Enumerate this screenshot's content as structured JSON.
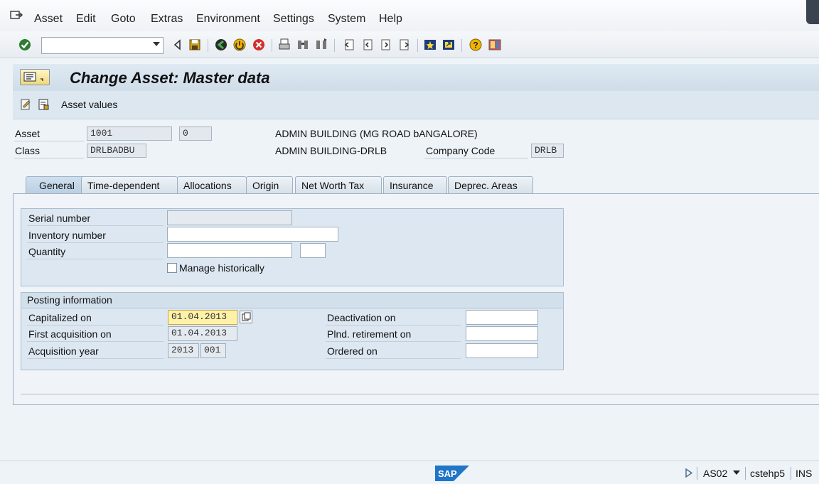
{
  "menu": {
    "items": [
      "Asset",
      "Edit",
      "Goto",
      "Extras",
      "Environment",
      "Settings",
      "System",
      "Help"
    ]
  },
  "toolbar": {
    "command_field_value": "",
    "icons": [
      "enter-icon",
      "back-icon",
      "save-icon",
      "back-green-icon",
      "exit-icon",
      "cancel-icon",
      "print-icon",
      "find-icon",
      "find-next-icon",
      "first-page-icon",
      "prev-page-icon",
      "next-page-icon",
      "last-page-icon",
      "new-session-icon",
      "shortcut-icon",
      "help-icon",
      "layout-icon"
    ]
  },
  "title": {
    "text": "Change Asset:  Master data"
  },
  "app_toolbar": {
    "asset_values_label": "Asset values"
  },
  "header": {
    "asset_label": "Asset",
    "asset_number": "1001",
    "sub_number": "0",
    "asset_description": "ADMIN BUILDING (MG ROAD bANGALORE)",
    "class_label": "Class",
    "class_value": "DRLBADBU",
    "class_description": "ADMIN BUILDING-DRLB",
    "company_code_label": "Company Code",
    "company_code_value": "DRLB"
  },
  "tabs": [
    {
      "label": "General",
      "active": true
    },
    {
      "label": "Time-dependent",
      "active": false
    },
    {
      "label": "Allocations",
      "active": false
    },
    {
      "label": "Origin",
      "active": false
    },
    {
      "label": "Net Worth Tax",
      "active": false
    },
    {
      "label": "Insurance",
      "active": false
    },
    {
      "label": "Deprec. Areas",
      "active": false
    }
  ],
  "general": {
    "serial_number_label": "Serial number",
    "serial_number_value": "",
    "inventory_number_label": "Inventory number",
    "inventory_number_value": "",
    "quantity_label": "Quantity",
    "quantity_value": "",
    "quantity_unit": "",
    "manage_historically_label": "Manage historically",
    "manage_historically_checked": false
  },
  "posting": {
    "title": "Posting information",
    "capitalized_on_label": "Capitalized on",
    "capitalized_on_value": "01.04.2013",
    "first_acquisition_label": "First acquisition on",
    "first_acquisition_value": "01.04.2013",
    "acquisition_year_label": "Acquisition year",
    "acquisition_year_value": "2013",
    "acquisition_period_value": "001",
    "deactivation_label": "Deactivation on",
    "deactivation_value": "",
    "planned_retirement_label": "Plnd. retirement on",
    "planned_retirement_value": "",
    "ordered_on_label": "Ordered on",
    "ordered_on_value": ""
  },
  "status": {
    "transaction": "AS02",
    "server": "cstehp5",
    "mode": "INS",
    "logo": "SAP"
  },
  "colors": {
    "title_bar": "#cfdde9",
    "focus_field": "#fff2a8",
    "sap_logo": "#1f75c7"
  }
}
